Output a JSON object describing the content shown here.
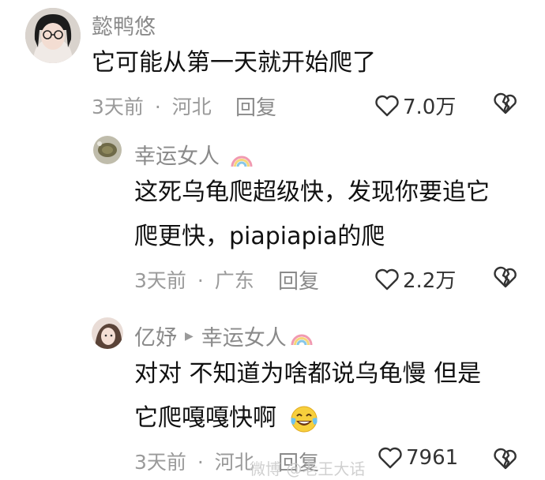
{
  "comments": [
    {
      "username": "懿鸭悠",
      "text_lines": [
        "它可能从第一天就开始爬了"
      ],
      "time": "3天前",
      "location": "河北",
      "reply_label": "回复",
      "likes": "7.0万"
    },
    {
      "username": "幸运女人",
      "text_lines": [
        "这死乌龟爬超级快，发现你要追它",
        "爬更快，piapiapia的爬"
      ],
      "time": "3天前",
      "location": "广东",
      "reply_label": "回复",
      "likes": "2.2万"
    },
    {
      "username": "亿妤",
      "reply_to": "幸运女人",
      "text_lines": [
        "对对 不知道为啥都说乌龟慢 但是",
        "它爬嘎嘎快啊"
      ],
      "time": "3天前",
      "location": "河北",
      "reply_label": "回复",
      "likes": "7961"
    }
  ],
  "separator": "·",
  "watermark": "微博 @老王大话",
  "icons": {
    "like": "heart-outline-icon",
    "dislike": "broken-heart-icon",
    "username_badge": "rainbow-icon",
    "reaction_emoji": "tears-of-joy-emoji"
  },
  "colors": {
    "meta_gray": "#9a9a9a",
    "text_black": "#111111"
  }
}
